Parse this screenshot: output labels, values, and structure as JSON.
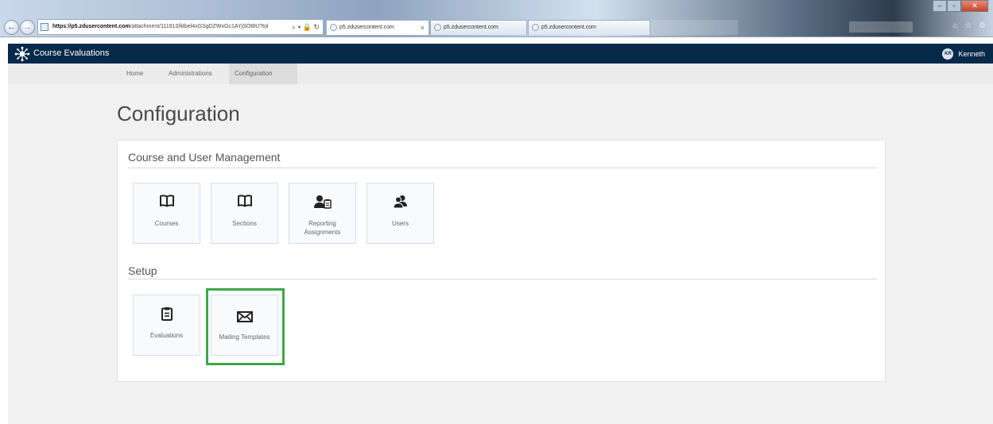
{
  "browser": {
    "url_bold": "https://p5.zdusercontent.com",
    "url_rest": "/attachment/111910/ktbel4xGSgDZWxGc1AYjSOt8U?tol",
    "url_tools": "⌕ ▾ 🔒 ↻",
    "tabs": [
      {
        "label": "p5.zdusercontent.com",
        "close": "×"
      },
      {
        "label": "p5.zdusercontent.com"
      },
      {
        "label": "p5.zdusercontent.com"
      }
    ],
    "nav_back": "←",
    "nav_forward": "→",
    "window_controls": {
      "minimize": "–",
      "maximize": "▫",
      "close": "✕"
    },
    "toolbar_icons": "⌂ ☆ ⚙"
  },
  "app": {
    "title": "Course Evaluations",
    "user": {
      "initials": "KR",
      "name": "Kenneth"
    },
    "header_color": "#07294a"
  },
  "nav": {
    "items": [
      {
        "label": "Home"
      },
      {
        "label": "Administrations"
      },
      {
        "label": "Configuration",
        "active": true
      }
    ]
  },
  "page": {
    "title": "Configuration",
    "sections": [
      {
        "heading": "Course and User Management",
        "tiles": [
          {
            "label": "Courses",
            "icon": "book-icon"
          },
          {
            "label": "Sections",
            "icon": "book-icon"
          },
          {
            "label": "Reporting Assignments",
            "icon": "user-clipboard-icon"
          },
          {
            "label": "Users",
            "icon": "users-icon"
          }
        ]
      },
      {
        "heading": "Setup",
        "tiles": [
          {
            "label": "Evaluations",
            "icon": "clipboard-icon"
          },
          {
            "label": "Mailing Templates",
            "icon": "envelope-icon",
            "highlighted": true
          }
        ]
      }
    ],
    "highlight_color": "#3aa84a"
  }
}
